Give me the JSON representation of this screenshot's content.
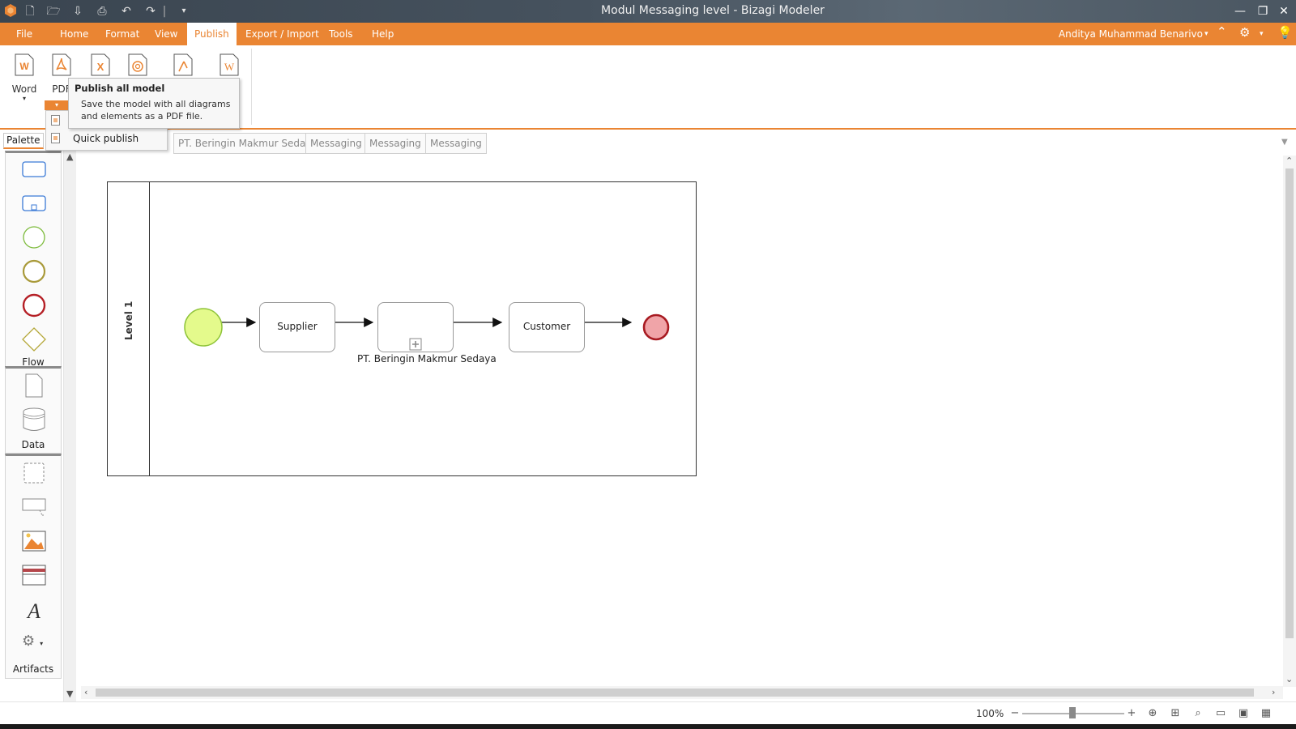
{
  "window": {
    "title": "Modul Messaging level - Bizagi Modeler"
  },
  "menu": {
    "items": [
      "File",
      "Home",
      "Format",
      "View",
      "Publish",
      "Export / Import",
      "Tools",
      "Help"
    ],
    "active": "Publish",
    "user_name": "Anditya Muhammad Benarivo"
  },
  "ribbon": {
    "word_label": "Word",
    "pdf_label": "PDF"
  },
  "tooltip": {
    "title": "Publish all model",
    "description": "Save the model with all diagrams and elements as a PDF file."
  },
  "dropdown": {
    "quick_publish": "Quick publish"
  },
  "tabs": {
    "palette": "Palette",
    "diagram_tabs": [
      "PT. Beringin Makmur Sedaya",
      "Messaging",
      "Messaging",
      "Messaging"
    ]
  },
  "palette": {
    "flow_label": "Flow",
    "data_label": "Data",
    "artifacts_label": "Artifacts"
  },
  "diagram": {
    "lane_label": "Level 1",
    "task_supplier": "Supplier",
    "task_customer": "Customer",
    "subprocess_label": "PT. Beringin Makmur Sedaya",
    "colors": {
      "start_event": "#e4fa8c",
      "end_event": "#f0a4a8",
      "end_event_border": "#a81b22",
      "accent": "#ea8533"
    }
  },
  "status": {
    "zoom": "100%"
  }
}
